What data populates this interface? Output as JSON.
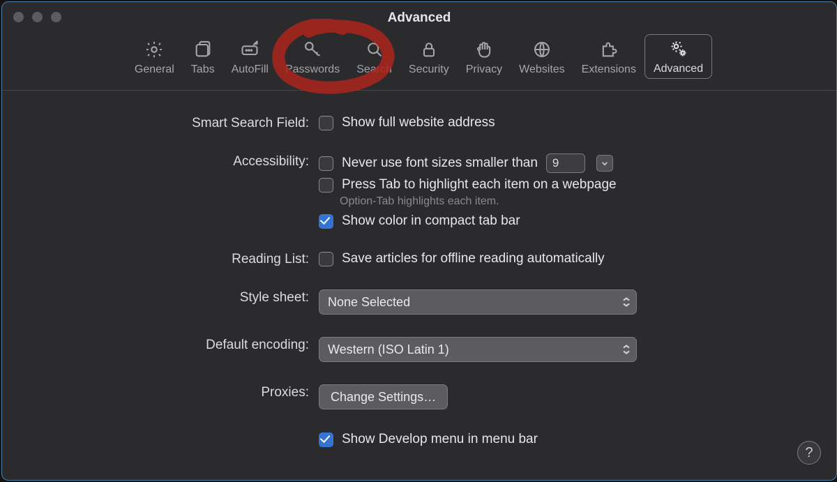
{
  "window_title": "Advanced",
  "tabs": [
    {
      "id": "general",
      "label": "General"
    },
    {
      "id": "tabs",
      "label": "Tabs"
    },
    {
      "id": "autofill",
      "label": "AutoFill"
    },
    {
      "id": "passwords",
      "label": "Passwords"
    },
    {
      "id": "search",
      "label": "Search"
    },
    {
      "id": "security",
      "label": "Security"
    },
    {
      "id": "privacy",
      "label": "Privacy"
    },
    {
      "id": "websites",
      "label": "Websites"
    },
    {
      "id": "extensions",
      "label": "Extensions"
    },
    {
      "id": "advanced",
      "label": "Advanced"
    }
  ],
  "active_tab": "advanced",
  "sections": {
    "smart_search": {
      "label": "Smart Search Field:",
      "show_full_url": {
        "label": "Show full website address",
        "checked": false
      }
    },
    "accessibility": {
      "label": "Accessibility:",
      "min_font": {
        "label": "Never use font sizes smaller than",
        "checked": false,
        "value": "9"
      },
      "press_tab": {
        "label": "Press Tab to highlight each item on a webpage",
        "checked": false
      },
      "hint": "Option-Tab highlights each item.",
      "compact_color": {
        "label": "Show color in compact tab bar",
        "checked": true
      }
    },
    "reading_list": {
      "label": "Reading List:",
      "save_offline": {
        "label": "Save articles for offline reading automatically",
        "checked": false
      }
    },
    "style_sheet": {
      "label": "Style sheet:",
      "value": "None Selected"
    },
    "default_encoding": {
      "label": "Default encoding:",
      "value": "Western (ISO Latin 1)"
    },
    "proxies": {
      "label": "Proxies:",
      "button": "Change Settings…"
    },
    "develop": {
      "label": "Show Develop menu in menu bar",
      "checked": true
    }
  },
  "help_glyph": "?",
  "annotation": {
    "shape": "hand-drawn-circle",
    "color": "#b3221a",
    "target_tab": "passwords"
  }
}
